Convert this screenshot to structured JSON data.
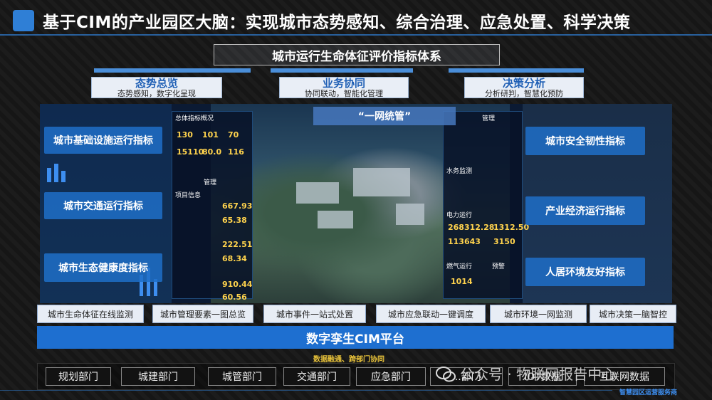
{
  "title": "基于CIM的产业园区大脑：实现城市态势感知、综合治理、应急处置、科学决策",
  "system_title": "城市运行生命体征评价指标体系",
  "categories": [
    {
      "title": "态势总览",
      "sub": "态势感知，数字化呈现"
    },
    {
      "title": "业务协同",
      "sub": "协同联动，智能化管理"
    },
    {
      "title": "决策分析",
      "sub": "分析研判，智慧化预防"
    }
  ],
  "screen": {
    "center_label": "“一网统管”",
    "left_indicators": [
      "城市基础设施运行指标",
      "城市交通运行指标",
      "城市生态健康度指标"
    ],
    "right_indicators": [
      "城市安全韧性指标",
      "产业经济运行指标",
      "人居环境友好指标"
    ],
    "stats": [
      "130",
      "101",
      "70",
      "15110",
      "80.0",
      "116",
      "667.93",
      "65.38",
      "222.51",
      "68.34",
      "910.44",
      "60.56",
      "268312.28",
      "1312.50",
      "113643",
      "3150",
      "1014"
    ],
    "panel_headers": [
      "总体指标概况",
      "管理",
      "项目信息",
      "电力运行",
      "燃气运行",
      "水务监测",
      "预警"
    ]
  },
  "modules": [
    "城市生命体征在线监测",
    "城市管理要素一图总览",
    "城市事件一站式处置",
    "城市应急联动一键调度",
    "城市环境一网监测",
    "城市决策一脑智控"
  ],
  "platform": "数字孪生CIM平台",
  "dept_label": "数据融通、跨部门协同",
  "departments": [
    "规划部门",
    "城建部门",
    "城管部门",
    "交通部门",
    "应急部门",
    "...部门",
    "IOT数据",
    "互联网数据"
  ],
  "watermark": "公众号 · 物联网报告中心",
  "footer": "智慧园区运营服务商",
  "colors": {
    "accent": "#2f7fd6",
    "platform": "#1e6fd0",
    "indicator": "#1e6ec8",
    "category_title": "#1f5fb5"
  }
}
